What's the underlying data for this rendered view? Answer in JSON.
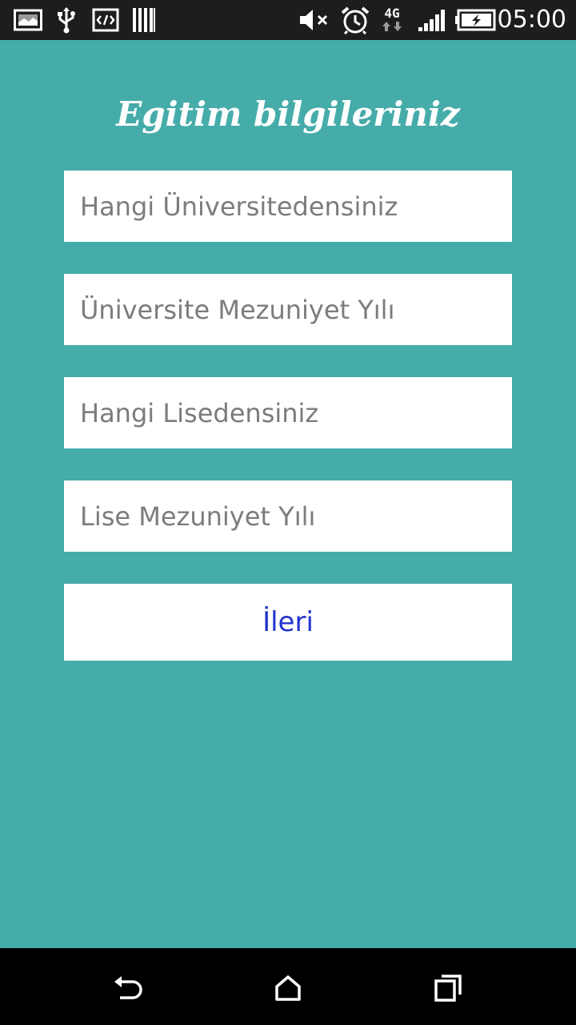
{
  "status_bar": {
    "time": "05:00",
    "network": "4G",
    "icons": [
      "screenshot-icon",
      "usb-icon",
      "code-icon",
      "barcode-icon",
      "mute-icon",
      "alarm-icon",
      "network-4g-icon",
      "signal-icon",
      "battery-charging-icon"
    ]
  },
  "page": {
    "title": "Egitim bilgileriniz"
  },
  "form": {
    "university": {
      "placeholder": "Hangi Üniversitedensiniz",
      "value": ""
    },
    "university_grad_year": {
      "placeholder": "Üniversite Mezuniyet Yılı",
      "value": ""
    },
    "high_school": {
      "placeholder": "Hangi Lisedensiniz",
      "value": ""
    },
    "high_school_grad_year": {
      "placeholder": "Lise Mezuniyet Yılı",
      "value": ""
    },
    "next_label": "İleri"
  },
  "nav_bar": {
    "icons": [
      "back-icon",
      "home-icon",
      "recents-icon"
    ]
  },
  "colors": {
    "background": "#46ACAA",
    "field_background": "#FFFFFF",
    "button_text": "#2233CC",
    "status_bar": "#1D1D1D",
    "nav_bar": "#000000"
  }
}
